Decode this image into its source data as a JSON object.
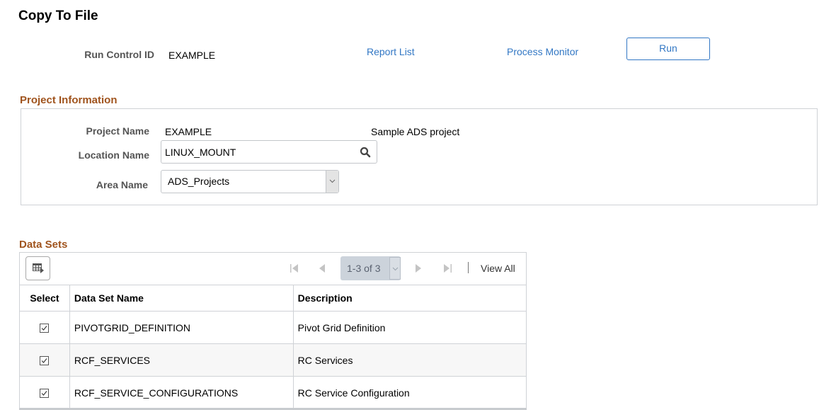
{
  "page": {
    "title": "Copy To File"
  },
  "header": {
    "run_control_label": "Run Control ID",
    "run_control_value": "EXAMPLE",
    "report_list_link": "Report List",
    "process_monitor_link": "Process Monitor",
    "run_button": "Run"
  },
  "project": {
    "section_title": "Project Information",
    "project_name_label": "Project Name",
    "project_name_value": "EXAMPLE",
    "project_description": "Sample ADS project",
    "location_label": "Location Name",
    "location_value": "LINUX_MOUNT",
    "location_icon": "search-icon",
    "area_label": "Area Name",
    "area_value": "ADS_Projects"
  },
  "datasets": {
    "section_title": "Data Sets",
    "pager_text": "1-3 of 3",
    "view_all": "View All",
    "columns": [
      "Select",
      "Data Set Name",
      "Description"
    ],
    "rows": [
      {
        "selected": true,
        "name": "PIVOTGRID_DEFINITION",
        "description": "Pivot Grid Definition"
      },
      {
        "selected": true,
        "name": "RCF_SERVICES",
        "description": "RC Services"
      },
      {
        "selected": true,
        "name": "RCF_SERVICE_CONFIGURATIONS",
        "description": "RC Service Configuration"
      }
    ]
  },
  "colors": {
    "link": "#3277c4",
    "section_title": "#a0541e",
    "border": "#cfd2d6"
  }
}
